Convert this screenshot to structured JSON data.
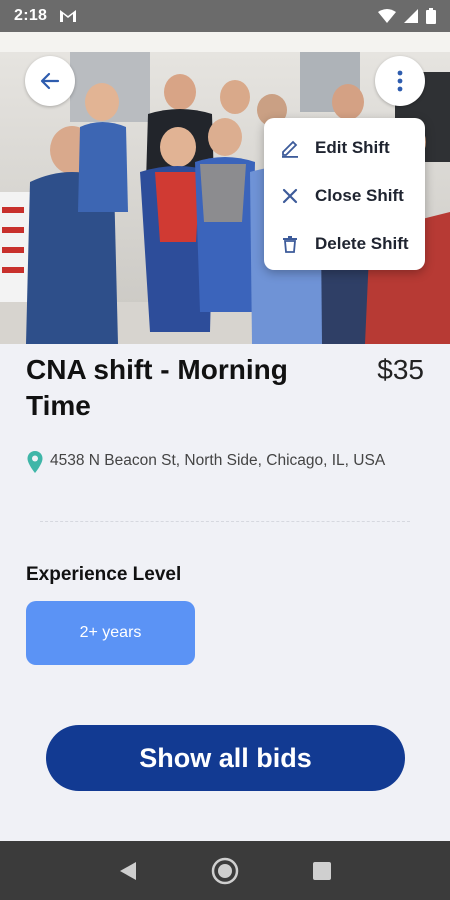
{
  "status_bar": {
    "time": "2:18",
    "notification_icon": "gmail-icon",
    "icons": [
      "wifi-icon",
      "signal-icon",
      "battery-icon"
    ]
  },
  "header": {
    "back_icon": "arrow-left-icon",
    "more_icon": "more-vert-icon",
    "hero_image": "photo of healthcare staff group"
  },
  "menu": {
    "items": [
      {
        "label": "Edit Shift",
        "icon": "pencil-icon"
      },
      {
        "label": "Close Shift",
        "icon": "close-icon"
      },
      {
        "label": "Delete Shift",
        "icon": "trash-icon"
      }
    ]
  },
  "shift": {
    "title": "CNA shift - Morning Time",
    "price": "$35",
    "address": "4538 N Beacon St, North Side, Chicago, IL, USA",
    "experience_label": "Experience Level",
    "experience_value": "2+ years",
    "show_bids_label": "Show all bids"
  },
  "colors": {
    "accent": "#5b93f5",
    "primary": "#123a92",
    "pin": "#3fb6a8",
    "menu_icon": "#3d5b9a"
  },
  "nav_bar": {
    "buttons": [
      "back-triangle-icon",
      "home-circle-icon",
      "recents-square-icon"
    ]
  }
}
